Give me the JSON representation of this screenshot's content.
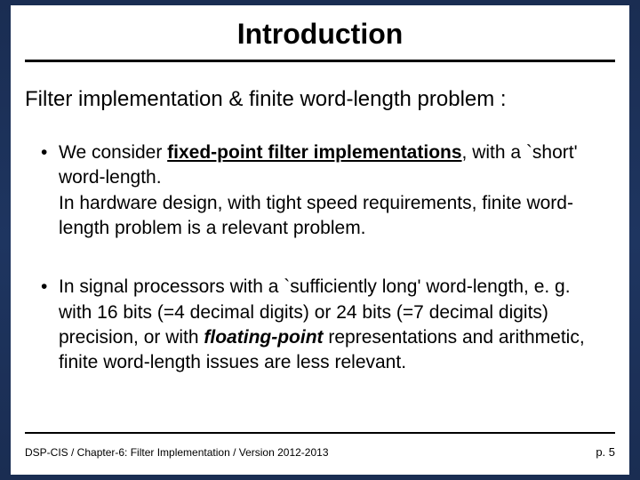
{
  "title": "Introduction",
  "subtitle": "Filter implementation & finite word-length problem :",
  "bullets": {
    "b1": {
      "pre": "We consider ",
      "emph": "fixed-point filter implementations",
      "post": ", with a `short' word-length.",
      "line2": "In hardware design, with tight speed requirements, finite word-length problem is a relevant problem."
    },
    "b2": {
      "pre": "In signal processors with a `sufficiently long'  word-length, e. g. with 16 bits (=4 decimal digits) or 24 bits (=7 decimal digits) precision, or with ",
      "emph": "floating-point",
      "post": " representations and arithmetic, finite word-length issues are less relevant."
    }
  },
  "footer": {
    "left": "DSP-CIS  /  Chapter-6: Filter Implementation  /  Version 2012-2013",
    "page": "p. 5"
  }
}
